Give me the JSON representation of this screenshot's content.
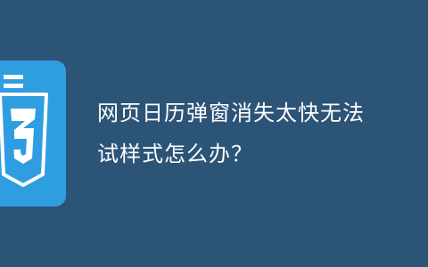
{
  "background_color": "#2c5477",
  "logo": {
    "icon": "css3-logo-icon",
    "tile_color": "#2f9ee0",
    "shield_color": "#ffffff"
  },
  "headline": {
    "line1": "网页日历弹窗消失太快无法",
    "line2": "试样式怎么办？"
  }
}
